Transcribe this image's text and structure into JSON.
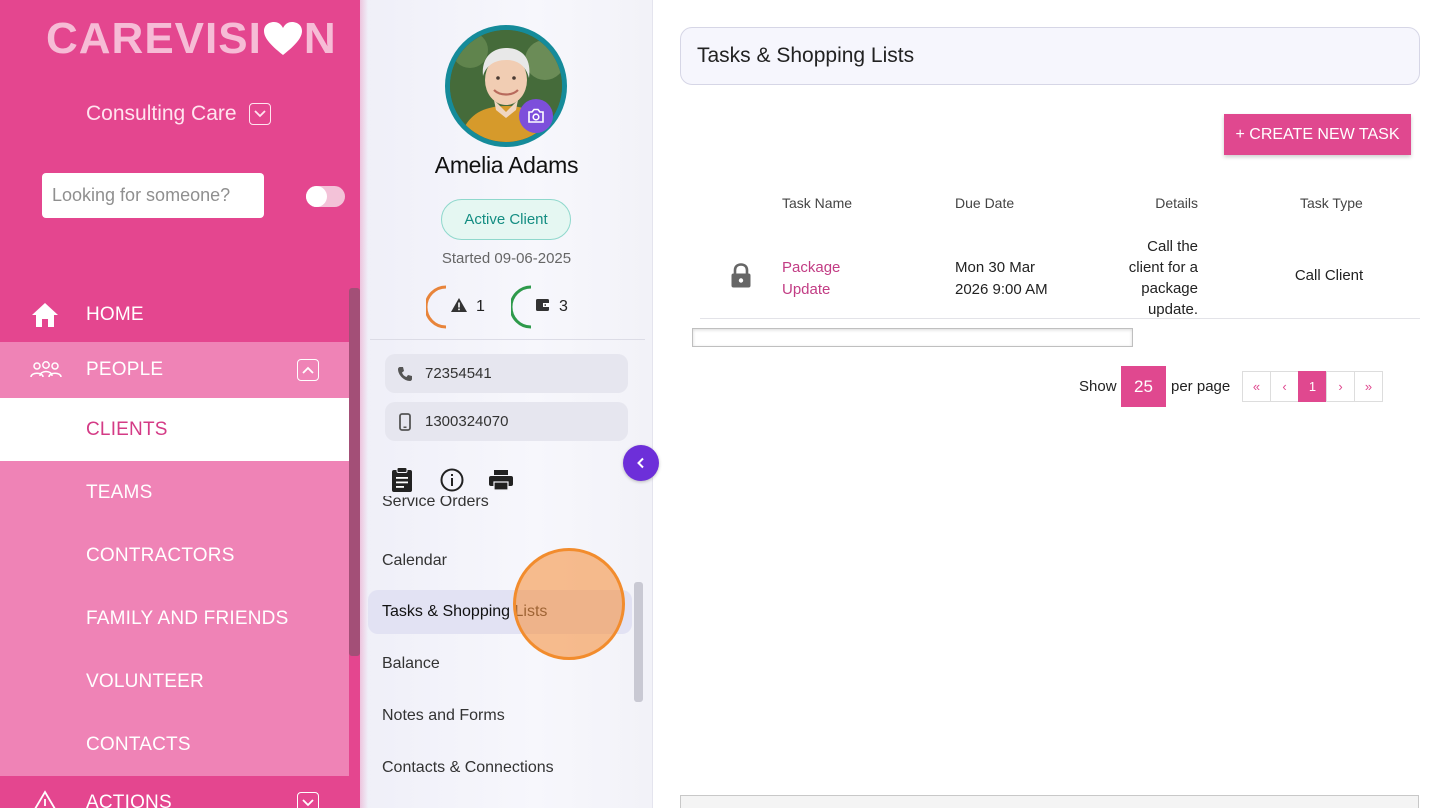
{
  "brand": {
    "logo_text_left": "CAREVISI",
    "logo_text_right": "N",
    "accent": "#e4468f"
  },
  "sidebar": {
    "org_name": "Consulting Care",
    "search_placeholder": "Looking for someone?",
    "nav": {
      "home": "HOME",
      "people": "PEOPLE",
      "clients": "CLIENTS",
      "teams": "TEAMS",
      "contractors": "CONTRACTORS",
      "family": "FAMILY AND FRIENDS",
      "volunteer": "VOLUNTEER",
      "contacts": "CONTACTS",
      "actions": "ACTIONS"
    }
  },
  "client": {
    "name": "Amelia Adams",
    "status": "Active Client",
    "started": "Started 09-06-2025",
    "alerts_count": "1",
    "wallet_count": "3",
    "phone": "72354541",
    "mobile": "1300324070",
    "menu": {
      "service_orders": "Service Orders",
      "calendar": "Calendar",
      "tasks": "Tasks & Shopping Lists",
      "balance": "Balance",
      "notes": "Notes and Forms",
      "contacts": "Contacts & Connections"
    }
  },
  "main": {
    "title": "Tasks & Shopping Lists",
    "create_button": "+ CREATE NEW TASK",
    "columns": {
      "name": "Task Name",
      "due": "Due Date",
      "details": "Details",
      "type": "Task Type"
    },
    "rows": [
      {
        "name_line1": "Package",
        "name_line2": "Update",
        "due_line1": "Mon 30 Mar",
        "due_line2": "2026 9:00 AM",
        "details": [
          "Call the",
          "client for a",
          "package",
          "update."
        ],
        "type": "Call Client"
      }
    ],
    "pagination": {
      "show_label": "Show",
      "per_page_value": "25",
      "per_page_label": "per page",
      "first": "«",
      "prev": "‹",
      "current": "1",
      "next": "›",
      "last": "»"
    }
  }
}
